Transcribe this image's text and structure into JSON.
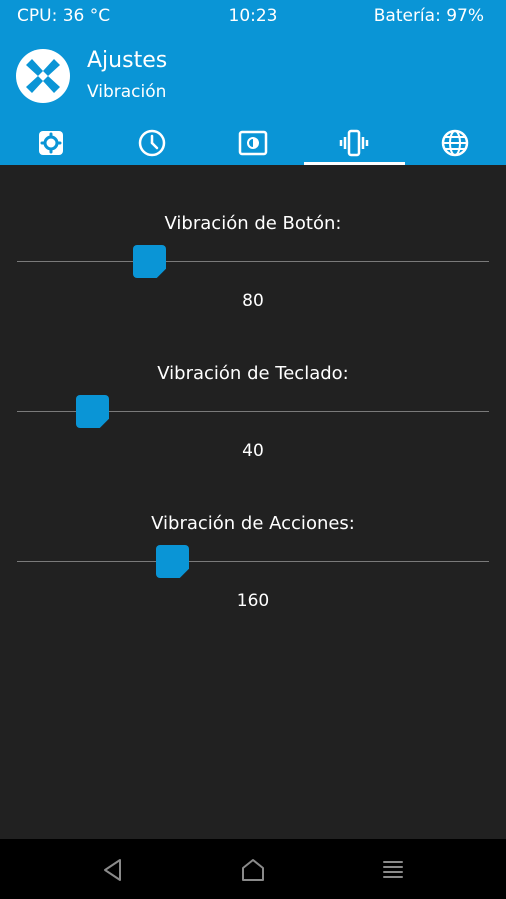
{
  "status_bar": {
    "cpu": "CPU: 36 °C",
    "time": "10:23",
    "battery": "Batería: 97%"
  },
  "header": {
    "title": "Ajustes",
    "subtitle": "Vibración"
  },
  "tabs": [
    {
      "icon": "gear-icon",
      "active": false
    },
    {
      "icon": "clock-icon",
      "active": false
    },
    {
      "icon": "screen-brightness-icon",
      "active": false
    },
    {
      "icon": "vibration-icon",
      "active": true
    },
    {
      "icon": "globe-icon",
      "active": false
    }
  ],
  "sliders": [
    {
      "label": "Vibración de Botón:",
      "value": "80",
      "level": 0.28
    },
    {
      "label": "Vibración de Teclado:",
      "value": "40",
      "level": 0.16
    },
    {
      "label": "Vibración de Acciones:",
      "value": "160",
      "level": 0.33
    }
  ],
  "navbar": {
    "icons": [
      "back-icon",
      "home-icon",
      "menu-icon"
    ]
  },
  "colors": {
    "accent": "#0a95d6",
    "background": "#212121",
    "navbar": "#000000",
    "text": "#ffffff"
  }
}
